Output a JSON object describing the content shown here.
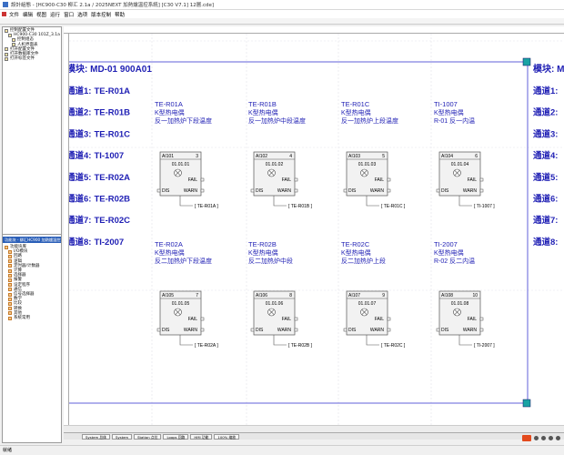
{
  "window": {
    "title": "設計組態 - [HC900-C30 柳汇 2.1a / 2025NEXT 加熱爐溫控系統] [C30 V7.1] 12層.cde]"
  },
  "menu": [
    "文件",
    "编辑",
    "视图",
    "运行",
    "窗口",
    "选项",
    "版本控制",
    "帮助"
  ],
  "left_tree": {
    "upper": [
      "控制配置文件",
      "HC900-C30 101Z_3.1a",
      "控制组态",
      "人机界面表",
      "打开配置文件",
      "打开数据库文件",
      "打开标签文件"
    ],
    "lower_header": "功能块 - 柳汇HC900 加熱爐溫控系統",
    "lower": [
      "功能块库",
      "I/O模块",
      "回路",
      "逻辑",
      "定时器/计数器",
      "计算",
      "选择器",
      "报警",
      "设定程序",
      "通信",
      "信号选择器",
      "数学",
      "比较",
      "转换",
      "其他",
      "系统常用"
    ]
  },
  "modules": [
    {
      "header": "模块:  MD-01   900A01",
      "channels": [
        {
          "label": "通道1:",
          "tag": "TE-R01A"
        },
        {
          "label": "通道2:",
          "tag": "TE-R01B"
        },
        {
          "label": "通道3:",
          "tag": "TE-R01C"
        },
        {
          "label": "通道4:",
          "tag": "TI-1007"
        },
        {
          "label": "通道5:",
          "tag": "TE-R02A"
        },
        {
          "label": "通道6:",
          "tag": "TE-R02B"
        },
        {
          "label": "通道7:",
          "tag": "TE-R02C"
        },
        {
          "label": "通道8:",
          "tag": "TI-2007"
        }
      ]
    }
  ],
  "right_page": {
    "header": "模块:  M",
    "channel_labels": [
      "通道1:",
      "通道2:",
      "通道3:",
      "通道4:",
      "通道5:",
      "通道6:",
      "通道7:",
      "通道8:"
    ]
  },
  "blocks": [
    {
      "title": "TE-R01A",
      "type": "K型热电偶",
      "desc": "反一加热炉下段温度",
      "ai": "AI101",
      "num": "3",
      "addr": "01.01.01",
      "fail": "FAIL",
      "dis": "DIS",
      "warn": "WARN",
      "tag": "[ TE-R01A ]"
    },
    {
      "title": "TE-R01B",
      "type": "K型热电偶",
      "desc": "反一加热炉中段温度",
      "ai": "AI102",
      "num": "4",
      "addr": "01.01.02",
      "fail": "FAIL",
      "dis": "DIS",
      "warn": "WARN",
      "tag": "[ TE-R01B ]"
    },
    {
      "title": "TE-R01C",
      "type": "K型热电偶",
      "desc": "反一加热炉上段温度",
      "ai": "AI103",
      "num": "5",
      "addr": "01.01.03",
      "fail": "FAIL",
      "dis": "DIS",
      "warn": "WARN",
      "tag": "[ TE-R01C ]"
    },
    {
      "title": "TI-1007",
      "type": "K型热电偶",
      "desc": "R-01 反一内温",
      "ai": "AI104",
      "num": "6",
      "addr": "01.01.04",
      "fail": "FAIL",
      "dis": "DIS",
      "warn": "WARN",
      "tag": "[ TI-1007 ]"
    },
    {
      "title": "TE-R02A",
      "type": "K型热电偶",
      "desc": "反二加热炉下段温度",
      "ai": "AI105",
      "num": "7",
      "addr": "01.01.05",
      "fail": "FAIL",
      "dis": "DIS",
      "warn": "WARN",
      "tag": "[ TE-R02A ]"
    },
    {
      "title": "TE-R02B",
      "type": "K型热电偶",
      "desc": "反二加热炉中段",
      "ai": "AI106",
      "num": "8",
      "addr": "01.01.06",
      "fail": "FAIL",
      "dis": "DIS",
      "warn": "WARN",
      "tag": "[ TE-R02B ]"
    },
    {
      "title": "TE-R02C",
      "type": "K型热电偶",
      "desc": "反二加热炉上段",
      "ai": "AI107",
      "num": "9",
      "addr": "01.01.07",
      "fail": "FAIL",
      "dis": "DIS",
      "warn": "WARN",
      "tag": "[ TE-R02C ]"
    },
    {
      "title": "TI-2007",
      "type": "K型热电偶",
      "desc": "R-02 反二内温",
      "ai": "AI108",
      "num": "10",
      "addr": "01.01.08",
      "fail": "FAIL",
      "dis": "DIS",
      "warn": "WARN",
      "tag": "[ TI-2007 ]"
    }
  ],
  "tabs": [
    "System 总体",
    "System",
    "Station 点位",
    "Loops 回路",
    "HMI 功能",
    "100% 缩放"
  ],
  "status": "就绪",
  "colors": {
    "accent": "#1f1fb4",
    "header_blue": "#2b5fb8",
    "handle": "#1aa3a3"
  }
}
